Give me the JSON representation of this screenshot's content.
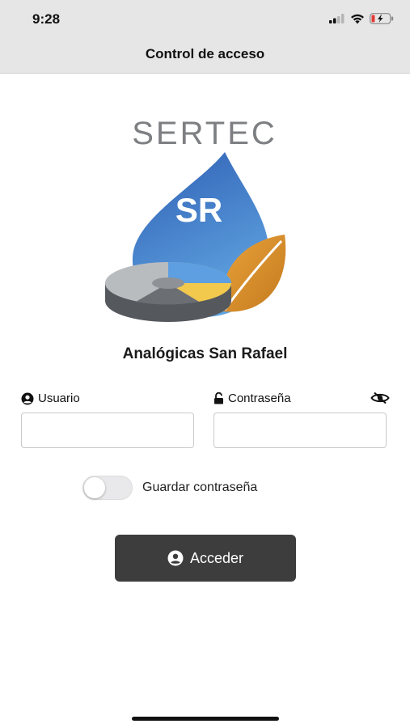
{
  "status_bar": {
    "time": "9:28"
  },
  "nav": {
    "title": "Control de acceso"
  },
  "logo": {
    "brand_text": "SERTEC",
    "mark_text": "SR"
  },
  "company_name": "Analógicas San Rafael",
  "form": {
    "username": {
      "label": "Usuario",
      "value": ""
    },
    "password": {
      "label": "Contraseña",
      "value": ""
    },
    "save_password": {
      "label": "Guardar contraseña",
      "enabled": false
    },
    "submit_label": "Acceder"
  },
  "colors": {
    "accent": "#3d3d3d",
    "logo_blue": "#3a78c9",
    "logo_orange": "#d9932c",
    "logo_yellow": "#f2c94c",
    "logo_gray": "#6b6f73"
  },
  "icons": {
    "signal": "signal-icon",
    "wifi": "wifi-icon",
    "battery": "battery-icon",
    "user": "user-icon",
    "lock": "lock-icon",
    "eye": "eye-slash-icon",
    "submit": "user-circle-icon"
  }
}
